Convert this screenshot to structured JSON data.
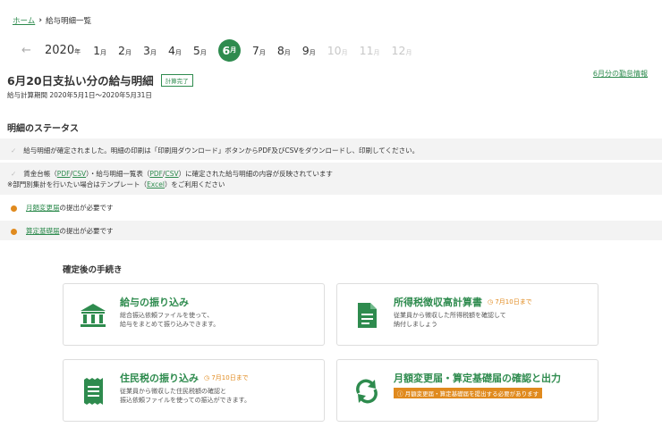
{
  "breadcrumb": {
    "home": "ホーム",
    "separator": "›",
    "current": "給与明細一覧"
  },
  "months": {
    "back": "←",
    "year": "2020",
    "year_unit": "年",
    "items": [
      {
        "num": "1",
        "unit": "月"
      },
      {
        "num": "2",
        "unit": "月"
      },
      {
        "num": "3",
        "unit": "月"
      },
      {
        "num": "4",
        "unit": "月"
      },
      {
        "num": "5",
        "unit": "月"
      },
      {
        "num": "6",
        "unit": "月"
      },
      {
        "num": "7",
        "unit": "月"
      },
      {
        "num": "8",
        "unit": "月"
      },
      {
        "num": "9",
        "unit": "月"
      },
      {
        "num": "10",
        "unit": "月"
      },
      {
        "num": "11",
        "unit": "月"
      },
      {
        "num": "12",
        "unit": "月"
      }
    ]
  },
  "header": {
    "title": "6月20日支払い分の給与明細",
    "badge": "計算完了",
    "attendance_link": "6月分の勤怠情報",
    "period": "給与計算期間 2020年5月1日～2020年5月31日"
  },
  "status": {
    "heading": "明細のステータス",
    "row1": "給与明細が確定されました。明細の印刷は「印刷用ダウンロード」ボタンからPDF及びCSVをダウンロードし、印刷してください。",
    "row2a_pre": "賃金台帳（",
    "row2a_pdf": "PDF",
    "row2a_slash": "/",
    "row2a_csv": "CSV",
    "row2a_mid": "）・給与明細一覧表（",
    "row2a_pdf2": "PDF",
    "row2a_csv2": "CSV",
    "row2a_post": "）に確定された給与明細の内容が反映されています",
    "row2b_pre": "※部門別集計を行いたい場合はテンプレート（",
    "row2b_link": "Excel",
    "row2b_post": "）をご利用ください",
    "row3_link": "月額変更届",
    "row3_text": "の提出が必要です",
    "row4_link": "算定基礎届",
    "row4_text": "の提出が必要です"
  },
  "procedures": {
    "heading": "確定後の手続き",
    "cards": [
      {
        "title": "給与の振り込み",
        "due": "",
        "desc1": "総合振込依頼ファイルを使って、",
        "desc2": "給与をまとめて振り込みできます。"
      },
      {
        "title": "所得税徴収高計算書",
        "due": "◷ 7月10日まで",
        "desc1": "従業員から徴収した所得税額を確認して",
        "desc2": "納付しましょう"
      },
      {
        "title": "住民税の振り込み",
        "due": "◷ 7月10日まで",
        "desc1": "従業員から徴収した住民税額の確認と",
        "desc2": "振込依頼ファイルを使っての振込ができます。"
      },
      {
        "title": "月額変更届・算定基礎届の確認と出力",
        "due": "",
        "alert": "ⓘ 月額変更届・算定基礎届を提出する必要があります"
      }
    ]
  },
  "colors": {
    "accent": "#2e8b4e",
    "warning": "#e08a1e",
    "row_bg": "#f3f3f3"
  }
}
